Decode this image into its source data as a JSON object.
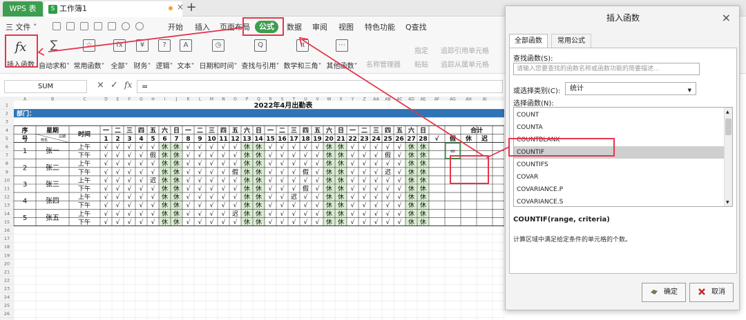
{
  "tabs": {
    "app": "WPS 表格",
    "doc_icon": "S",
    "doc": "工作簿1",
    "close": "×",
    "new": "+"
  },
  "menubar": {
    "file": "三 文件 ˅",
    "items": [
      "开始",
      "插入",
      "页面布局",
      "公式",
      "数据",
      "审阅",
      "视图",
      "特色功能"
    ],
    "search": "Q查找"
  },
  "ribbon": {
    "items": [
      {
        "label": "插入函数",
        "icon": "fx"
      },
      {
        "label": "自动求和˅",
        "icon": "∑"
      },
      {
        "label": "常用函数˅",
        "icon": "☆"
      },
      {
        "label": "全部˅",
        "icon": "fx"
      },
      {
        "label": "财务˅",
        "icon": "¥"
      },
      {
        "label": "逻辑˅",
        "icon": "?"
      },
      {
        "label": "文本˅",
        "icon": "A"
      },
      {
        "label": "日期和时间˅",
        "icon": "◷"
      },
      {
        "label": "查找与引用˅",
        "icon": "Q"
      },
      {
        "label": "数学和三角˅",
        "icon": "π"
      },
      {
        "label": "其他函数˅",
        "icon": "⋯"
      }
    ],
    "disabled": [
      "名称管理器",
      "指定",
      "粘贴",
      "追踪引用单元格",
      "追踪从属单元格"
    ]
  },
  "formula_bar": {
    "name_box": "SUM",
    "cancel": "×",
    "confirm": "✓",
    "fx": "fx",
    "content": "="
  },
  "sheet": {
    "title": "2022年4月出勤表",
    "dept": "部门：",
    "hdr_seq": [
      "序",
      "号"
    ],
    "hdr_week": "星期",
    "hdr_date": "日期",
    "hdr_name": "姓名",
    "hdr_time": "时间",
    "hdr_total": "合计",
    "total_cols": [
      "√",
      "假",
      "休",
      "迟"
    ],
    "col_letters": [
      "A",
      "B",
      "C",
      "D",
      "E",
      "F",
      "G",
      "H",
      "I",
      "J",
      "K",
      "L",
      "M",
      "N",
      "O",
      "P",
      "Q",
      "R",
      "S",
      "T",
      "U",
      "V",
      "W",
      "X",
      "Y",
      "Z",
      "AA",
      "AB",
      "AC",
      "AD",
      "AE",
      "AF",
      "AG",
      "AH",
      "AI"
    ],
    "weekdays": [
      "一",
      "二",
      "三",
      "四",
      "五",
      "六",
      "日",
      "一",
      "二",
      "三",
      "四",
      "五",
      "六",
      "日",
      "一",
      "二",
      "三",
      "四",
      "五",
      "六",
      "日",
      "一",
      "二",
      "三",
      "四",
      "五",
      "六",
      "日"
    ],
    "days": [
      "1",
      "2",
      "3",
      "4",
      "5",
      "6",
      "7",
      "8",
      "9",
      "10",
      "11",
      "12",
      "13",
      "14",
      "15",
      "16",
      "17",
      "18",
      "19",
      "20",
      "21",
      "22",
      "23",
      "24",
      "25",
      "26",
      "27",
      "28"
    ],
    "am": "上午",
    "pm": "下午",
    "check": "√",
    "rest": "休",
    "rest_days": [
      6,
      7,
      13,
      14,
      20,
      21,
      27,
      28
    ],
    "employees": [
      {
        "no": "1",
        "name": "张一",
        "am": {},
        "pm": {
          "5": "假",
          "25": "假"
        }
      },
      {
        "no": "2",
        "name": "张二",
        "am": {},
        "pm": {
          "12": "假",
          "18": "假",
          "25": "迟"
        }
      },
      {
        "no": "3",
        "name": "张三",
        "am": {
          "5": "迟"
        },
        "pm": {
          "18": "假"
        }
      },
      {
        "no": "4",
        "name": "张四",
        "am": {
          "17": "迟"
        },
        "pm": {}
      },
      {
        "no": "5",
        "name": "张五",
        "am": {
          "12": "迟"
        },
        "pm": {}
      }
    ],
    "active_value": "="
  },
  "dialog": {
    "title": "插入函数",
    "close": "×",
    "tab_all": "全部函数",
    "tab_common": "常用公式",
    "search_label": "查找函数(S):",
    "search_placeholder": "请输入您要查找的函数名称或函数功能的简要描述...",
    "category_label": "或选择类别(C):",
    "category_value": "统计",
    "list_label": "选择函数(N):",
    "functions": [
      "COUNT",
      "COUNTA",
      "COUNTBLANK",
      "COUNTIF",
      "COUNTIFS",
      "COVAR",
      "COVARIANCE.P",
      "COVARIANCE.S"
    ],
    "selected": "COUNTIF",
    "signature": "COUNTIF(range, criteria)",
    "description": "计算区域中满足给定条件的单元格的个数。",
    "ok": "确定",
    "cancel": "取消"
  },
  "colors": {
    "highlight": "#e8334a",
    "wps_green": "#3c9e4e",
    "dept_bar": "#2f74b5",
    "rest_fill": "#dbeed3"
  }
}
